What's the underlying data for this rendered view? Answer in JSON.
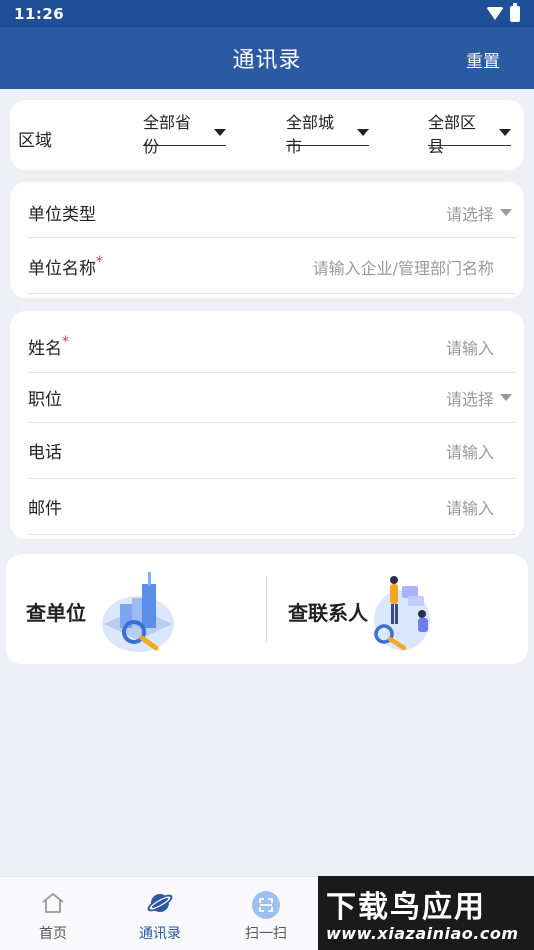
{
  "status_bar": {
    "time": "11:26"
  },
  "header": {
    "title": "通讯录",
    "reset_label": "重置"
  },
  "region": {
    "label": "区域",
    "province": "全部省份",
    "city": "全部城市",
    "district": "全部区县"
  },
  "unit": {
    "type_label": "单位类型",
    "type_placeholder": "请选择",
    "name_label": "单位名称",
    "name_required": "*",
    "name_placeholder": "请输入企业/管理部门名称"
  },
  "person": {
    "name_label": "姓名",
    "name_required": "*",
    "name_placeholder": "请输入",
    "position_label": "职位",
    "position_placeholder": "请选择",
    "phone_label": "电话",
    "phone_placeholder": "请输入",
    "email_label": "邮件",
    "email_placeholder": "请输入"
  },
  "query": {
    "unit_label": "查单位",
    "contact_label": "查联系人"
  },
  "nav": {
    "items": [
      {
        "label": "首页",
        "icon": "home-icon"
      },
      {
        "label": "通讯录",
        "icon": "planet-icon"
      },
      {
        "label": "扫一扫",
        "icon": "scan-icon"
      }
    ]
  },
  "watermark": {
    "title": "下载鸟应用",
    "url": "www.xiazainiao.com"
  },
  "colors": {
    "primary": "#2b5aa3",
    "status_bar": "#1f4f96",
    "background": "#eef0f5",
    "required": "#e53935"
  }
}
